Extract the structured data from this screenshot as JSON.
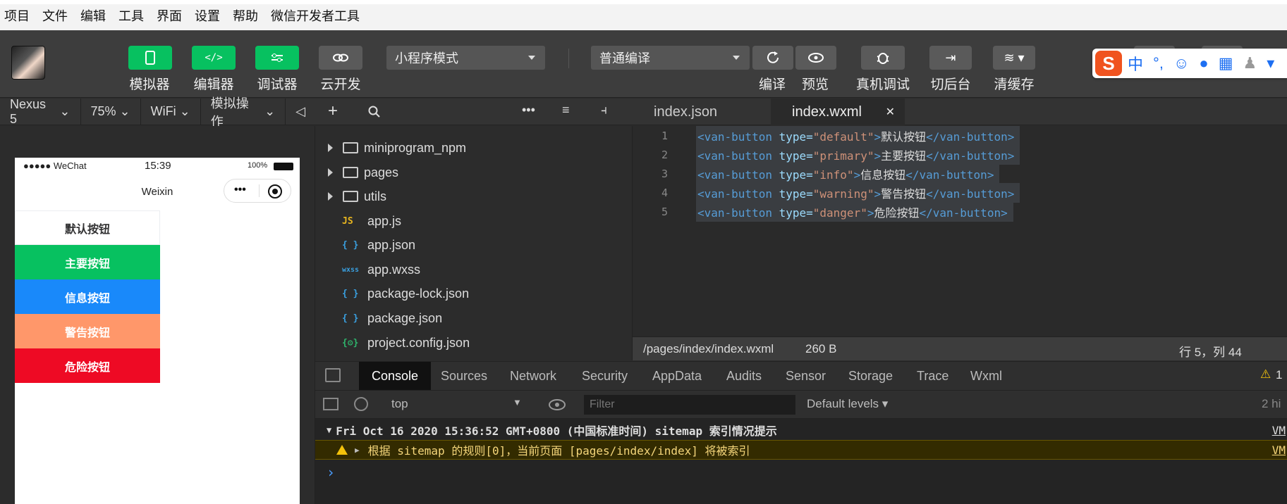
{
  "menu": [
    "项目",
    "文件",
    "编辑",
    "工具",
    "界面",
    "设置",
    "帮助",
    "微信开发者工具"
  ],
  "toolbar": {
    "simulator": "模拟器",
    "editor": "编辑器",
    "debugger": "调试器",
    "cloud": "云开发",
    "mode_select": "小程序模式",
    "compile_select": "普通编译",
    "compile": "编译",
    "preview": "预览",
    "remote_debug": "真机调试",
    "background": "切后台",
    "clear_cache": "清缓存"
  },
  "ime": {
    "logo": "S",
    "cn": "中",
    "punct": "°,",
    "emoji": "☺"
  },
  "simbar": {
    "device": "Nexus 5",
    "zoom": "75%",
    "network": "WiFi",
    "ops": "模拟操作"
  },
  "phone": {
    "carrier": "●●●●● WeChat",
    "time": "15:39",
    "battery": "100%",
    "title": "Weixin",
    "buttons": [
      {
        "label": "默认按钮",
        "bg": "#ffffff",
        "fg": "#323233"
      },
      {
        "label": "主要按钮",
        "bg": "#07c160",
        "fg": "#ffffff"
      },
      {
        "label": "信息按钮",
        "bg": "#1989fa",
        "fg": "#ffffff"
      },
      {
        "label": "警告按钮",
        "bg": "#ff976a",
        "fg": "#ffffff"
      },
      {
        "label": "危险按钮",
        "bg": "#ee0a24",
        "fg": "#ffffff"
      }
    ]
  },
  "files": [
    {
      "name": "miniprogram_npm",
      "kind": "folder"
    },
    {
      "name": "pages",
      "kind": "folder"
    },
    {
      "name": "utils",
      "kind": "folder"
    },
    {
      "name": "app.js",
      "kind": "file",
      "icon": "JS",
      "color": "#e7b51f"
    },
    {
      "name": "app.json",
      "kind": "file",
      "icon": "{ }",
      "color": "#3aa0e0"
    },
    {
      "name": "app.wxss",
      "kind": "file",
      "icon": "wxss",
      "color": "#3aa0e0"
    },
    {
      "name": "package-lock.json",
      "kind": "file",
      "icon": "{ }",
      "color": "#3aa0e0"
    },
    {
      "name": "package.json",
      "kind": "file",
      "icon": "{ }",
      "color": "#3aa0e0"
    },
    {
      "name": "project.config.json",
      "kind": "file",
      "icon": "{⚙}",
      "color": "#2fb56c"
    }
  ],
  "tabs": [
    {
      "name": "index.json"
    },
    {
      "name": "index.wxml",
      "close": "✕"
    }
  ],
  "code": [
    {
      "num": "1",
      "open": "<van-button",
      "attr": " type=",
      "val": "\"default\"",
      "mid": ">",
      "text": "默认按钮",
      "close": "</van-button>"
    },
    {
      "num": "2",
      "open": "<van-button",
      "attr": " type=",
      "val": "\"primary\"",
      "mid": ">",
      "text": "主要按钮",
      "close": "</van-button>"
    },
    {
      "num": "3",
      "open": "<van-button",
      "attr": " type=",
      "val": "\"info\"",
      "mid": ">",
      "text": "信息按钮",
      "close": "</van-button>"
    },
    {
      "num": "4",
      "open": "<van-button",
      "attr": " type=",
      "val": "\"warning\"",
      "mid": ">",
      "text": "警告按钮",
      "close": "</van-button>"
    },
    {
      "num": "5",
      "open": "<van-button",
      "attr": " type=",
      "val": "\"danger\"",
      "mid": ">",
      "text": "危险按钮",
      "close": "</van-button>"
    }
  ],
  "edstatus": {
    "path": "/pages/index/index.wxml",
    "size": "260 B",
    "cursor": "行 5，列 44"
  },
  "devtabs": [
    "Console",
    "Sources",
    "Network",
    "Security",
    "AppData",
    "Audits",
    "Sensor",
    "Storage",
    "Trace",
    "Wxml"
  ],
  "devtools": {
    "warn_count": "1",
    "context": "top",
    "filter_placeholder": "Filter",
    "levels": "Default levels",
    "hidden": "2 hi"
  },
  "console": {
    "group": "Fri Oct 16 2020 15:36:52 GMT+0800 (中国标准时间) sitemap 索引情况提示",
    "warning": "根据 sitemap 的规则[0]，当前页面 [pages/index/index] 将被索引",
    "source": "VM",
    "prompt": "›"
  }
}
